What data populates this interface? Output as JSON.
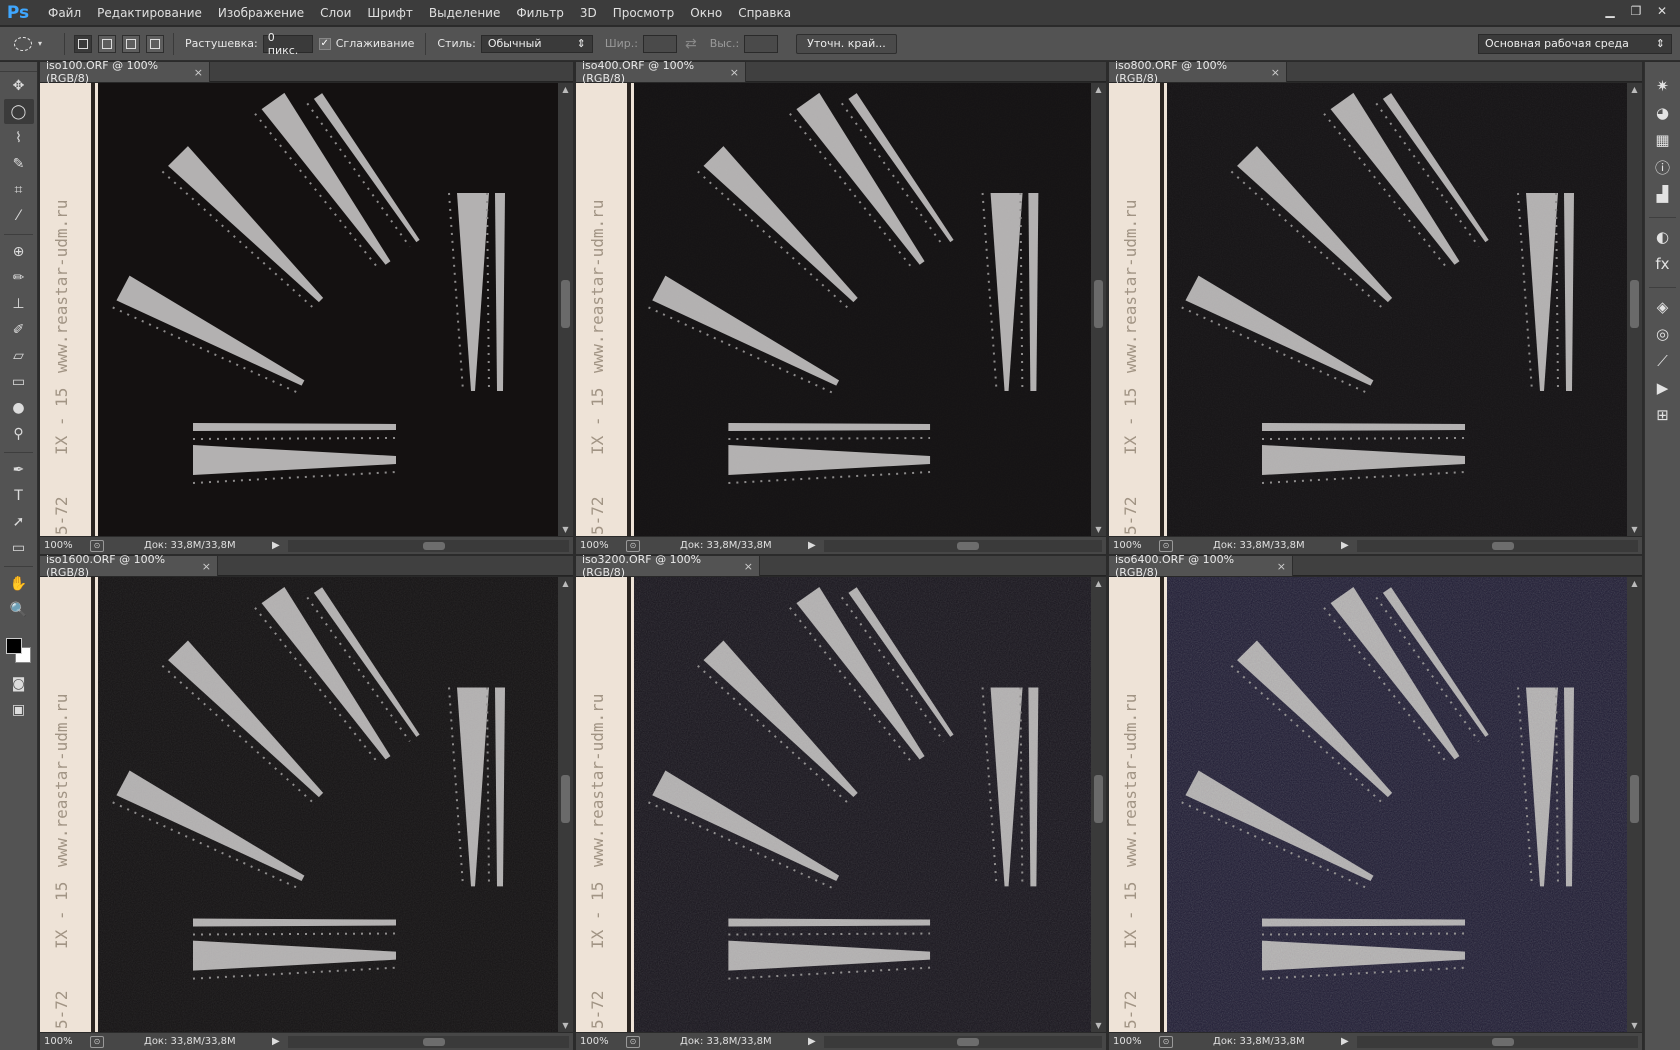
{
  "app": {
    "logo": "Ps",
    "menu": [
      "Файл",
      "Редактирование",
      "Изображение",
      "Слои",
      "Шрифт",
      "Выделение",
      "Фильтр",
      "3D",
      "Просмотр",
      "Окно",
      "Справка"
    ],
    "window_controls": [
      "minimize-icon",
      "restore-icon",
      "close-icon"
    ]
  },
  "options": {
    "feather_label": "Растушевка:",
    "feather_value": "0 пикс.",
    "antialias_label": "Сглаживание",
    "antialias_checked": true,
    "style_label": "Стиль:",
    "style_value": "Обычный",
    "width_label": "Шир.:",
    "height_label": "Выс.:",
    "refine_button": "Уточн. край...",
    "workspace": "Основная рабочая среда"
  },
  "documents": [
    {
      "title": "iso100.ORF @ 100% (RGB/8)",
      "zoom": "100%",
      "doc_size": "Док: 33,8M/33,8M",
      "noise": 0.0,
      "bg": "#141111"
    },
    {
      "title": "iso400.ORF @ 100% (RGB/8)",
      "zoom": "100%",
      "doc_size": "Док: 33,8M/33,8M",
      "noise": 0.1,
      "bg": "#141213"
    },
    {
      "title": "iso800.ORF @ 100% (RGB/8)",
      "zoom": "100%",
      "doc_size": "Док: 33,8M/33,8M",
      "noise": 0.2,
      "bg": "#151315"
    },
    {
      "title": "iso1600.ORF @ 100% (RGB/8)",
      "zoom": "100%",
      "doc_size": "Док: 33,8M/33,8M",
      "noise": 0.35,
      "bg": "#151314"
    },
    {
      "title": "iso3200.ORF @ 100% (RGB/8)",
      "zoom": "100%",
      "doc_size": "Док: 33,8M/33,8M",
      "noise": 0.55,
      "bg": "#17141c"
    },
    {
      "title": "iso6400.ORF @ 100% (RGB/8)",
      "zoom": "100%",
      "doc_size": "Док: 33,8M/33,8M",
      "noise": 0.8,
      "bg": "#1b1830"
    }
  ],
  "image_text": {
    "url": "www.reastar-udm.ru",
    "model": "IX - 15",
    "year": "5-72"
  },
  "tools": [
    "move-icon",
    "elliptical-marquee-icon",
    "lasso-icon",
    "quick-selection-icon",
    "crop-icon",
    "eyedropper-icon",
    "spot-healing-icon",
    "brush-icon",
    "clone-stamp-icon",
    "history-brush-icon",
    "eraser-icon",
    "gradient-icon",
    "blur-icon",
    "dodge-icon",
    "pen-icon",
    "type-icon",
    "path-selection-icon",
    "rectangle-icon",
    "hand-icon",
    "zoom-icon"
  ],
  "tool_glyphs": [
    "✥",
    "◯",
    "⌇",
    "✎",
    "⌗",
    "⁄",
    "⊕",
    "✏",
    "⊥",
    "✐",
    "▱",
    "▭",
    "●",
    "⚲",
    "✒",
    "T",
    "➚",
    "▭",
    "✋",
    "🔍"
  ],
  "panel_icons": [
    "navigator-icon",
    "color-icon",
    "swatches-icon",
    "info-icon",
    "histogram-icon",
    "adjustments-icon",
    "styles-icon",
    "layers-icon",
    "channels-icon",
    "paths-icon",
    "actions-icon",
    "properties-icon"
  ],
  "panel_glyphs": [
    "✷",
    "◕",
    "▦",
    "ⓘ",
    "▟",
    "◐",
    "fx",
    "◈",
    "◎",
    "⟋",
    "▶",
    "⊞"
  ]
}
